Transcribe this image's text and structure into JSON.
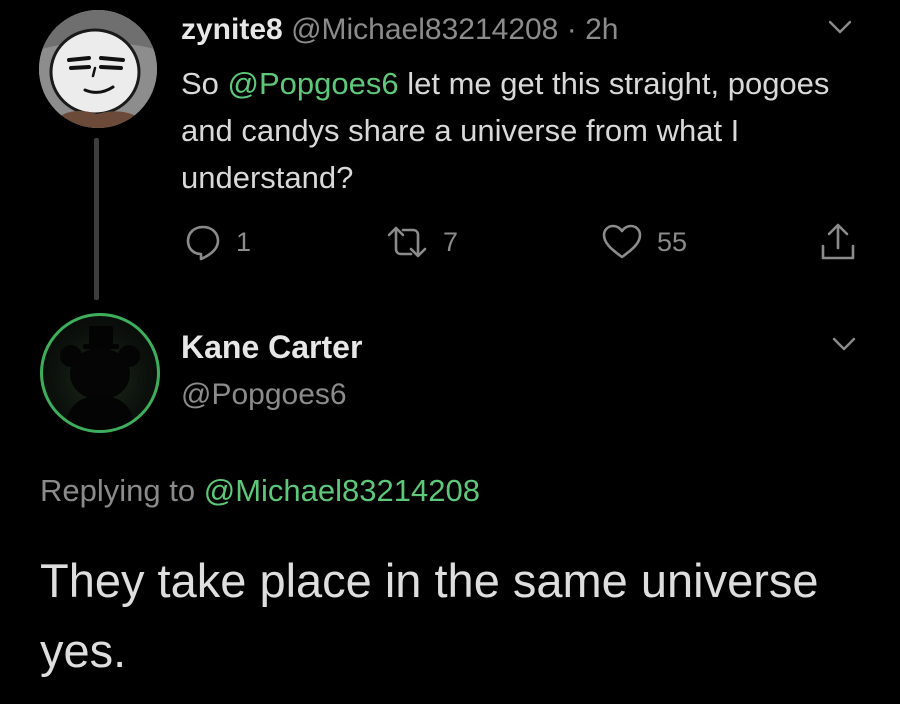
{
  "tweet1": {
    "display_name": "zynite8",
    "handle": "@Michael83214208",
    "separator": "·",
    "time": "2h",
    "text_before": "So ",
    "mention": "@Popgoes6",
    "text_after": " let me get this straight, pogoes and candys share a universe from what I understand?",
    "actions": {
      "replies": "1",
      "retweets": "7",
      "likes": "55"
    }
  },
  "tweet2": {
    "display_name": "Kane Carter",
    "handle": "@Popgoes6",
    "replying_prefix": "Replying to ",
    "replying_handle": "@Michael83214208",
    "text": "They take place in the same universe yes."
  },
  "icons": {
    "reply": "comment-bubble-icon",
    "retweet": "retweet-arrows-icon",
    "like": "heart-icon",
    "share": "share-upload-icon",
    "more": "chevron-down-icon"
  },
  "colors": {
    "background": "#000000",
    "mention_green": "#5ec77a",
    "secondary_text": "#8b8b8b",
    "avatar_ring_green": "#3fae5c"
  }
}
